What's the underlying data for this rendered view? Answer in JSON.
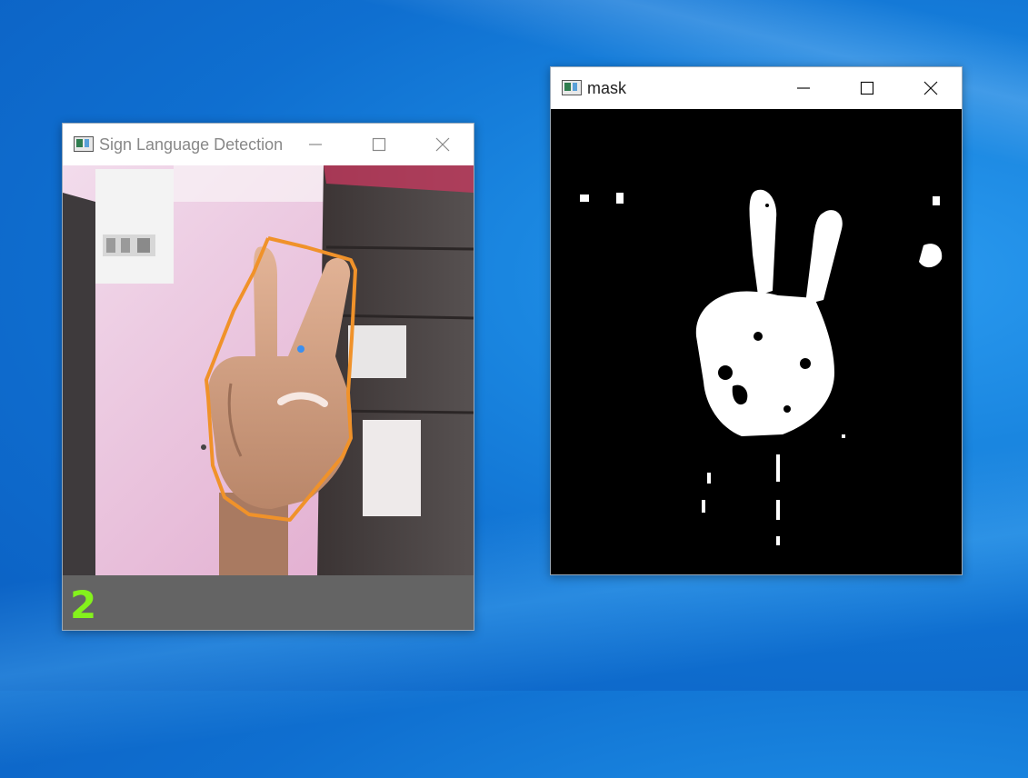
{
  "windows": {
    "detection": {
      "title": "Sign Language Detection",
      "predicted_label": "2",
      "controls": [
        "minimize",
        "maximize",
        "close"
      ]
    },
    "mask": {
      "title": "mask",
      "controls": [
        "minimize",
        "maximize",
        "close"
      ]
    }
  },
  "colors": {
    "contour": "#f0922a",
    "label": "#84f21c",
    "desktop_accent": "#1a86e0"
  }
}
